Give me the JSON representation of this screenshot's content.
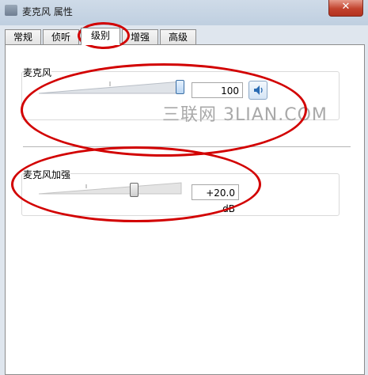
{
  "window": {
    "title": "麦克风 属性",
    "close_label": "✕"
  },
  "tabs": [
    {
      "label": "常规",
      "active": false
    },
    {
      "label": "侦听",
      "active": false
    },
    {
      "label": "级别",
      "active": true
    },
    {
      "label": "增强",
      "active": false
    },
    {
      "label": "高级",
      "active": false
    }
  ],
  "levels": {
    "microphone": {
      "label": "麦克风",
      "value": "100",
      "slider_fraction": 1.0
    },
    "boost": {
      "label": "麦克风加强",
      "value": "+20.0 dB",
      "slider_fraction": 0.67
    }
  },
  "watermark": "三联网 3LIAN.COM",
  "colors": {
    "annotation_red": "#d20000",
    "accent_blue": "#3a6ea5"
  },
  "icons": {
    "speaker": "speaker-icon",
    "app": "app-icon"
  }
}
